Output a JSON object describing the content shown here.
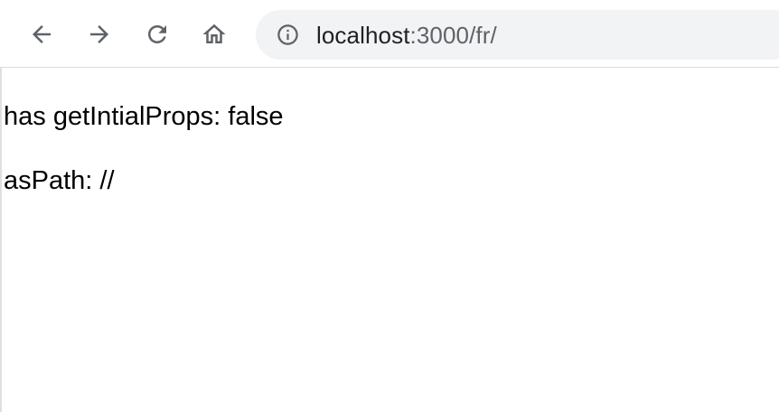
{
  "toolbar": {
    "back_icon": "arrow-left-icon",
    "forward_icon": "arrow-right-icon",
    "reload_icon": "reload-icon",
    "home_icon": "home-icon"
  },
  "address_bar": {
    "info_icon": "info-circle-icon",
    "host": "localhost",
    "rest": ":3000/fr/"
  },
  "page": {
    "line1": "has getIntialProps: false",
    "line2": "asPath: //"
  },
  "colors": {
    "icon": "#5f6368",
    "omnibox_bg": "#f1f3f4",
    "text": "#000000"
  }
}
